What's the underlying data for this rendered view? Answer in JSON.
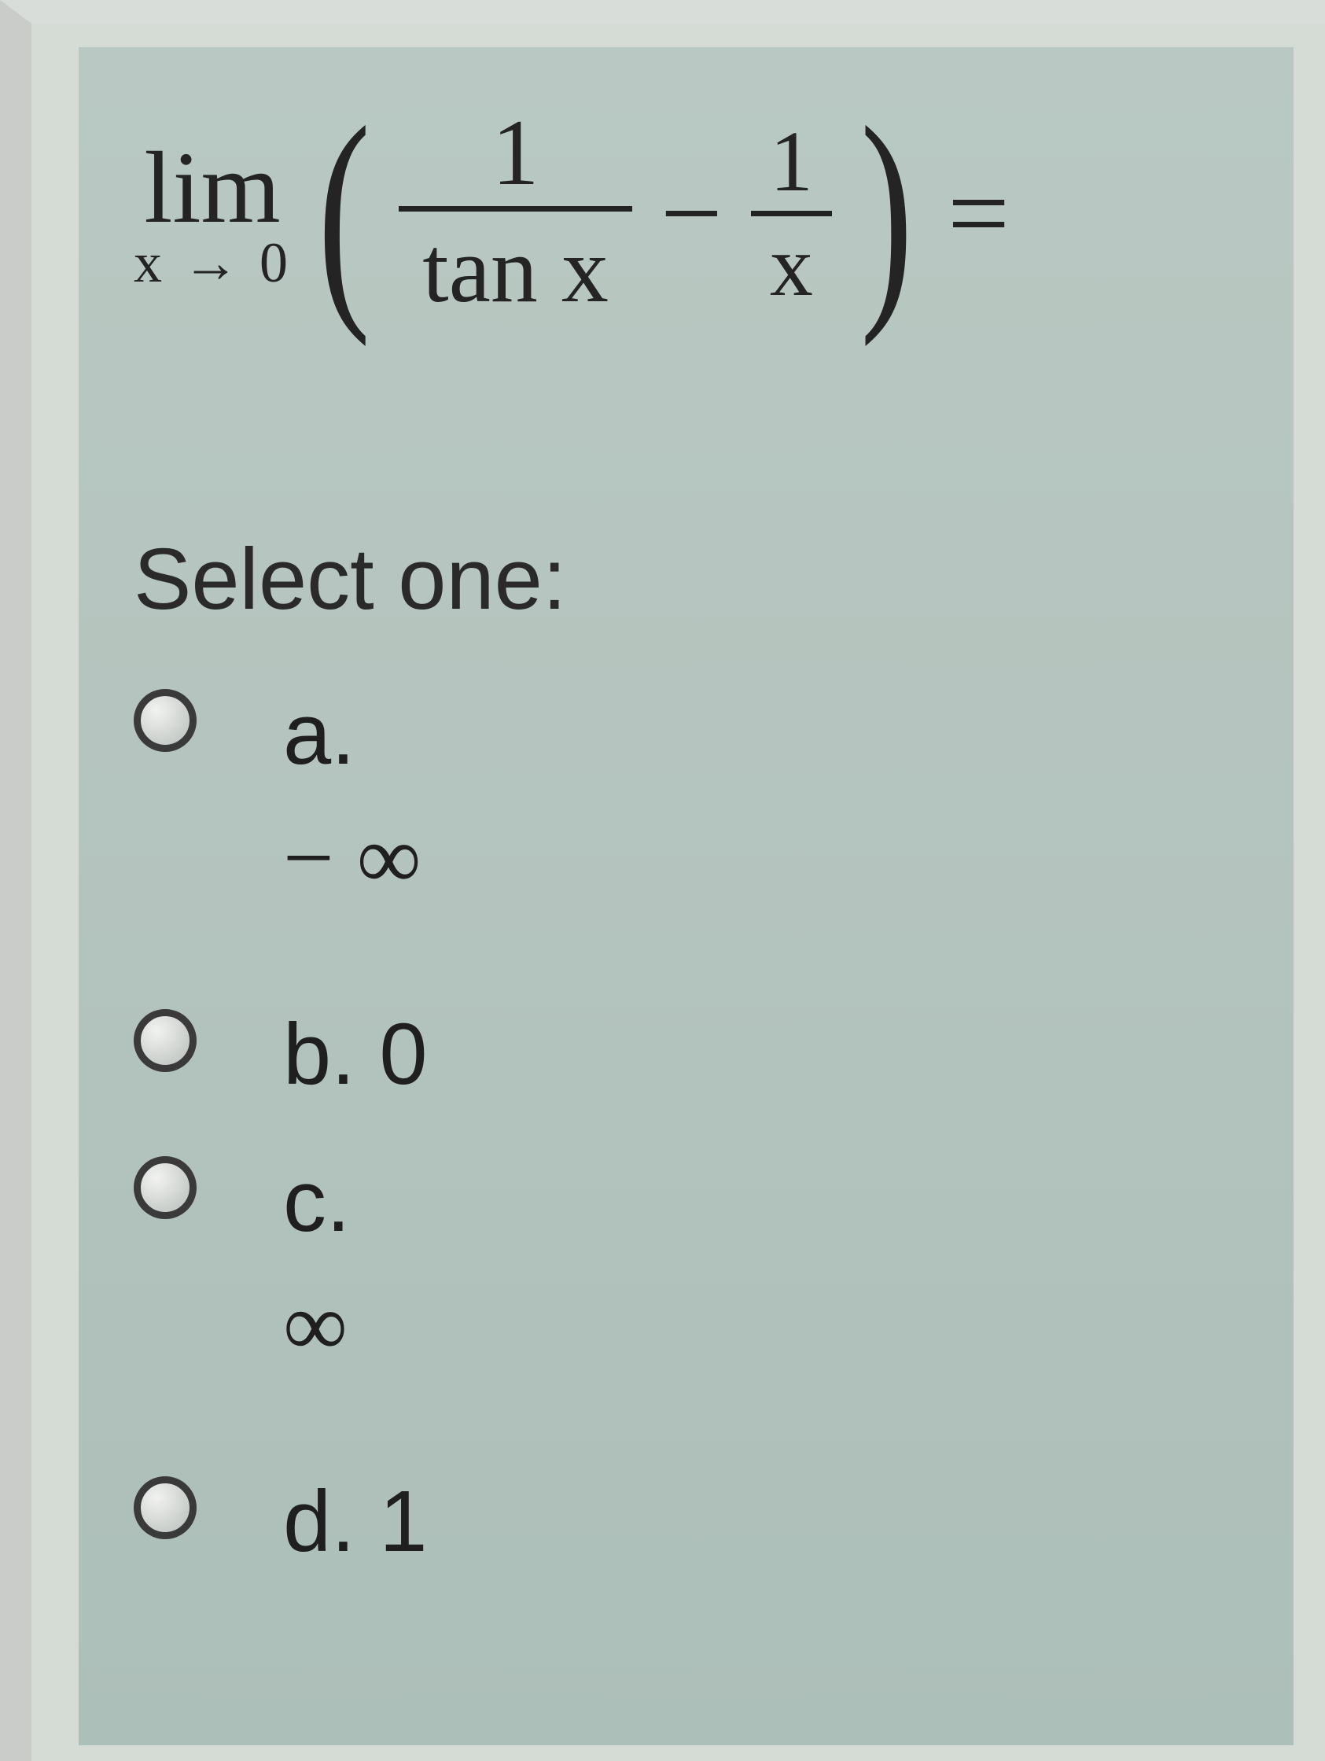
{
  "question": {
    "lim_text": "lim",
    "lim_sub": "x → 0",
    "frac1_num": "1",
    "frac1_den": "tan x",
    "minus": "−",
    "frac2_num": "1",
    "frac2_den": "x",
    "equals": "="
  },
  "prompt": "Select one:",
  "options": [
    {
      "id": "a",
      "label": "a.",
      "value": "− ∞"
    },
    {
      "id": "b",
      "label": "b.",
      "value": "0"
    },
    {
      "id": "c",
      "label": "c.",
      "value": "∞"
    },
    {
      "id": "d",
      "label": "d.",
      "value": "1"
    }
  ]
}
